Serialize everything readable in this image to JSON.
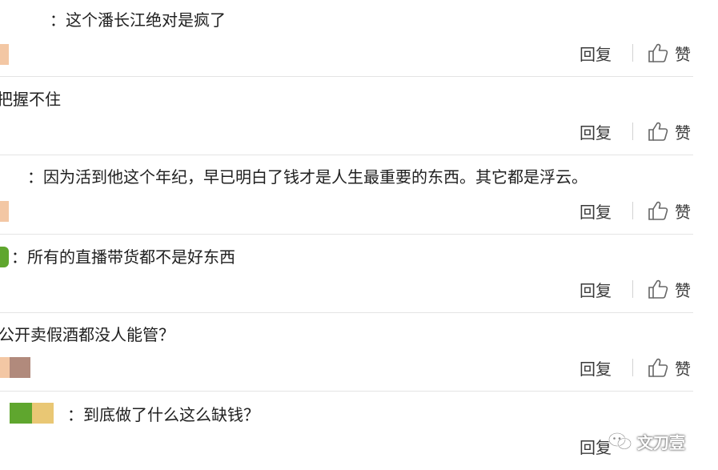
{
  "actions": {
    "reply_label": "回复",
    "like_label": "赞"
  },
  "comments": [
    {
      "text": "：这个潘长江绝对是疯了"
    },
    {
      "text": "把握不住"
    },
    {
      "text": "：因为活到他这个年纪，早已明白了钱才是人生最重要的东西。其它都是浮云。"
    },
    {
      "text": "：所有的直播带货都不是好东西"
    },
    {
      "text": "公开卖假酒都没人能管？"
    },
    {
      "text": "：到底做了什么这么缺钱？"
    }
  ],
  "watermark": {
    "text": "文刀壹"
  },
  "colors": {
    "avatar_peach": "#f3c7a4",
    "avatar_green": "#5fa62e",
    "avatar_brown": "#b18a7c",
    "avatar_yellow": "#e9c774",
    "divider": "#e4e4e4"
  }
}
